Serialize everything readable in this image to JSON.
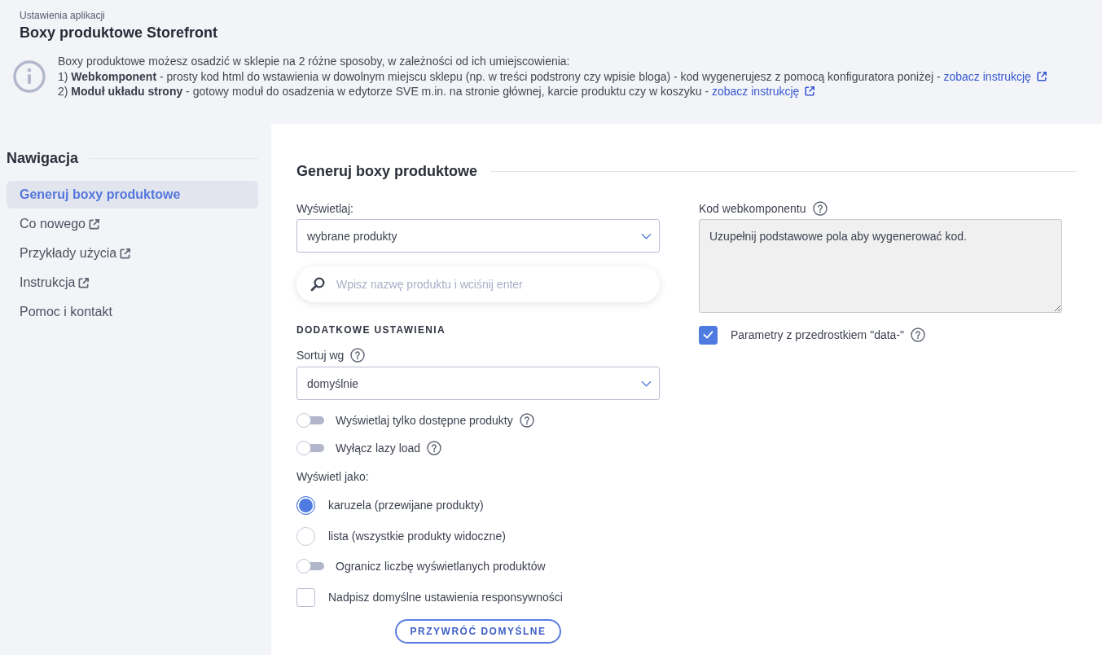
{
  "header": {
    "breadcrumb": "Ustawienia aplikacji",
    "title": "Boxy produktowe Storefront"
  },
  "info": {
    "lines": [
      {
        "text": "Boxy produktowe możesz osadzić w sklepie na 2 różne sposoby, w zależności od ich umiejscowienia:"
      },
      {
        "text": "1) **Webkomponent** - prosty kod html do wstawienia w dowolnym miejscu sklepu (np. w treści podstrony czy wpisie bloga) - kod wygenerujesz z pomocą konfiguratora poniżej -",
        "link": "zobacz instrukcję"
      },
      {
        "text": "2) **Moduł układu strony** - gotowy moduł do osadzenia w edytorze SVE m.in. na stronie głównej, karcie produktu czy w koszyku -",
        "link": "zobacz instrukcję"
      }
    ]
  },
  "sidebar": {
    "title": "Nawigacja",
    "items": [
      {
        "label": "Generuj boxy produktowe",
        "selected": true,
        "external": false
      },
      {
        "label": "Co nowego",
        "selected": false,
        "external": true
      },
      {
        "label": "Przykłady użycia",
        "selected": false,
        "external": true
      },
      {
        "label": "Instrukcja",
        "selected": false,
        "external": true
      },
      {
        "label": "Pomoc i kontakt",
        "selected": false,
        "external": false
      }
    ]
  },
  "form": {
    "title": "Generuj boxy produktowe",
    "display": {
      "label": "Wyświetlaj:",
      "value": "wybrane produkty"
    },
    "search": {
      "placeholder": "Wpisz nazwę produktu i wciśnij enter"
    },
    "settings_title": "DODATKOWE USTAWIENIA",
    "sort": {
      "label": "Sortuj wg",
      "help": true,
      "value": "domyślnie"
    },
    "options": [
      {
        "kind": "toggle",
        "label": "Wyświetlaj tylko dostępne produkty",
        "on": false,
        "help": true
      },
      {
        "kind": "toggle",
        "label": "Wyłącz lazy load",
        "on": false,
        "help": true
      },
      {
        "kind": "label",
        "label": "Wyświetl jako:"
      },
      {
        "kind": "radio",
        "label": "karuzela (przewijane produkty)",
        "selected": true
      },
      {
        "kind": "radio",
        "label": "lista (wszystkie produkty widoczne)",
        "selected": false
      },
      {
        "kind": "toggle",
        "label": "Ogranicz liczbę wyświetlanych produktów",
        "on": false
      },
      {
        "kind": "checkbox",
        "label": "Nadpisz domyślne ustawienia responsywności",
        "checked": false
      }
    ],
    "reset_button": "PRZYWRÓĆ DOMYŚLNE"
  },
  "code_panel": {
    "label": "Kod webkomponentu",
    "help": true,
    "value": "Uzupełnij podstawowe pola aby wygenerować kod.",
    "data_prefix": {
      "label": "Parametry z przedrostkiem \"data-\"",
      "checked": true,
      "help": true
    }
  }
}
